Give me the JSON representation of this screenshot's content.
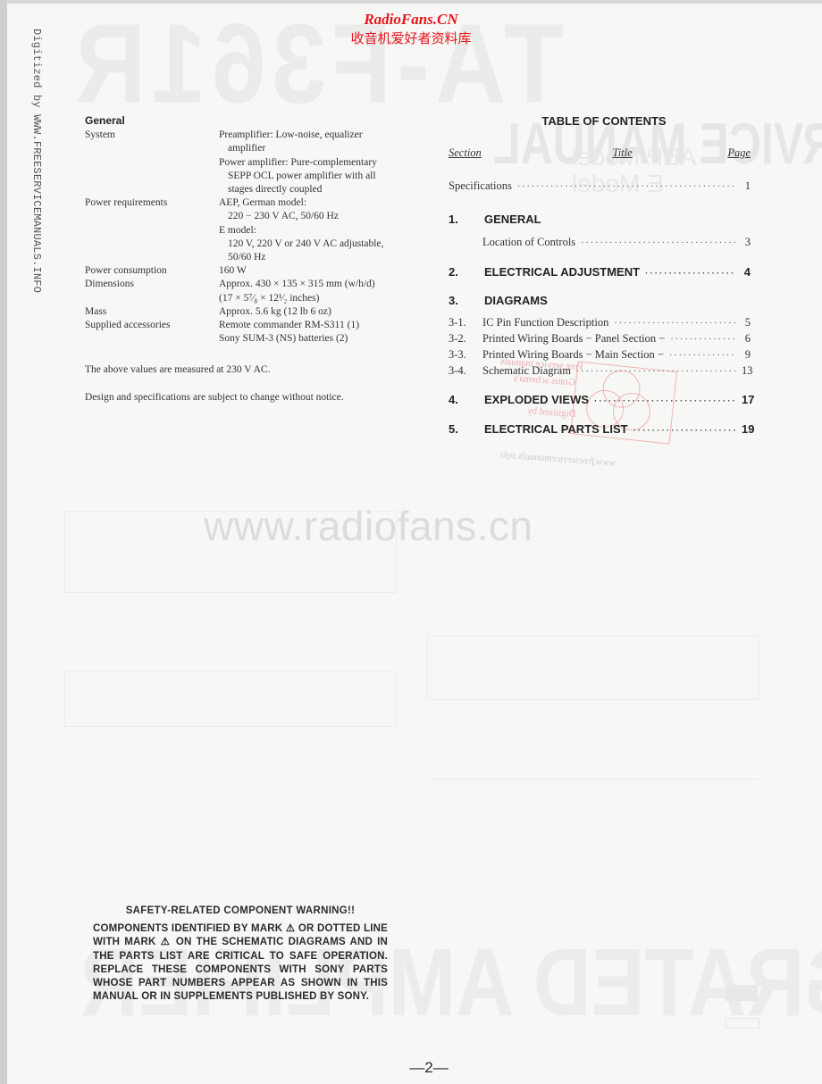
{
  "watermarks": {
    "brand_en": "RadioFans.CN",
    "brand_cn": "收音机爱好者资料库",
    "side_note": "Digitized by WWW.FREESERVICEMANUALS.INFO",
    "center": "www.radiofans.cn",
    "ghost_model": "TA-F361R",
    "ghost_manual": "SERVICE MANUAL",
    "ghost_aep": "AEP Model",
    "ghost_e": "E Model",
    "ghost_bottom": "INTEGRATED AMPLIFIER",
    "stamp_lines": [
      "Free service manuals",
      "Gratis schema's",
      "Digitized by",
      "www.freeservicemanuals.info"
    ]
  },
  "specs": {
    "heading": "General",
    "rows": [
      {
        "label": "System",
        "lines": [
          {
            "text": "Preamplifier: Low-noise, equalizer",
            "indent": false
          },
          {
            "text": "amplifier",
            "indent": true
          },
          {
            "text": "Power amplifier: Pure-complementary",
            "indent": false
          },
          {
            "text": "SEPP OCL power amplifier with all",
            "indent": true
          },
          {
            "text": "stages directly coupled",
            "indent": true
          }
        ]
      },
      {
        "label": "Power requirements",
        "lines": [
          {
            "text": "AEP, German model:",
            "indent": false
          },
          {
            "text": "220 − 230 V AC, 50/60 Hz",
            "indent": true
          },
          {
            "text": "E model:",
            "indent": false
          },
          {
            "text": "120 V, 220 V or 240 V AC adjustable,",
            "indent": true
          },
          {
            "text": "50/60 Hz",
            "indent": true
          }
        ]
      },
      {
        "label": "Power consumption",
        "lines": [
          {
            "text": "160 W",
            "indent": false
          }
        ]
      },
      {
        "label": "Dimensions",
        "lines": [
          {
            "text": "Approx. 430 × 135 × 315 mm (w/h/d)",
            "indent": false
          },
          {
            "text": "(17 × 5⁷⁄₈ × 12¹⁄₂ inches)",
            "indent": false
          }
        ]
      },
      {
        "label": "Mass",
        "lines": [
          {
            "text": "Approx. 5.6 kg (12 lb 6 oz)",
            "indent": false
          }
        ]
      },
      {
        "label": "Supplied accessories",
        "lines": [
          {
            "text": "Remote commander RM-S311 (1)",
            "indent": false
          },
          {
            "text": "Sony SUM-3 (NS) batteries (2)",
            "indent": false
          }
        ]
      }
    ],
    "note1": "The above values are measured at 230 V AC.",
    "note2": "Design and specifications are subject to change without notice."
  },
  "toc": {
    "title": "TABLE OF CONTENTS",
    "col_section": "Section",
    "col_title": "Title",
    "col_page": "Page",
    "entries": [
      {
        "num": "",
        "text": "Specifications",
        "page": "1",
        "major": false
      },
      {
        "num": "1.",
        "text": "GENERAL",
        "page": "",
        "major": true
      },
      {
        "num": "",
        "text": "Location of Controls",
        "page": "3",
        "major": false
      },
      {
        "num": "2.",
        "text": "ELECTRICAL ADJUSTMENT",
        "page": "4",
        "major": true
      },
      {
        "num": "3.",
        "text": "DIAGRAMS",
        "page": "",
        "major": true
      },
      {
        "num": "3-1.",
        "text": "IC Pin Function Description",
        "page": "5",
        "major": false
      },
      {
        "num": "3-2.",
        "text": "Printed Wiring Boards − Panel Section −",
        "page": "6",
        "major": false
      },
      {
        "num": "3-3.",
        "text": "Printed Wiring Boards − Main Section −",
        "page": "9",
        "major": false
      },
      {
        "num": "3-4.",
        "text": "Schematic Diagram",
        "page": "13",
        "major": false
      },
      {
        "num": "4.",
        "text": "EXPLODED VIEWS",
        "page": "17",
        "major": true
      },
      {
        "num": "5.",
        "text": "ELECTRICAL PARTS LIST",
        "page": "19",
        "major": true
      }
    ]
  },
  "warning": {
    "title": "SAFETY-RELATED COMPONENT WARNING!!",
    "body": "COMPONENTS IDENTIFIED BY MARK ⚠ OR DOTTED LINE WITH MARK ⚠ ON THE SCHEMATIC DIAGRAMS AND IN THE PARTS LIST ARE CRITICAL TO SAFE OPERATION. REPLACE THESE COMPONENTS WITH SONY PARTS WHOSE PART NUMBERS APPEAR AS SHOWN IN THIS MANUAL OR IN SUPPLEMENTS PUBLISHED BY SONY."
  },
  "footer": {
    "page_number": "—2—"
  }
}
